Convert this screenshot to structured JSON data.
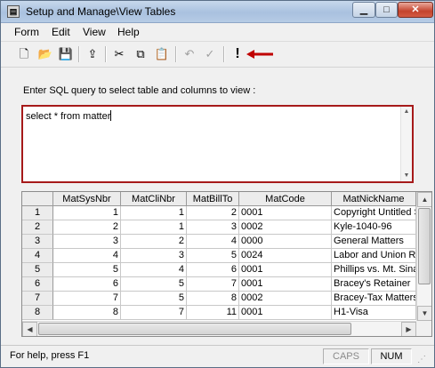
{
  "window": {
    "title": "Setup and Manage\\View Tables"
  },
  "menu": [
    "Form",
    "Edit",
    "View",
    "Help"
  ],
  "toolbar": {
    "buttons": [
      "new-icon",
      "open-icon",
      "save-icon",
      "up-folder-icon",
      "cut-icon",
      "copy-icon",
      "paste-icon",
      "undo-icon",
      "spellcheck-icon",
      "execute-icon"
    ],
    "execute_glyph": "!",
    "arrow_color": "#c00000"
  },
  "query": {
    "prompt": "Enter SQL query to select table and columns to view :",
    "value": "select * from matter",
    "border_color": "#a61a1a"
  },
  "table": {
    "columns": [
      "MatSysNbr",
      "MatCliNbr",
      "MatBillTo",
      "MatCode",
      "MatNickName"
    ],
    "rows": [
      [
        "1",
        "1",
        "1",
        "2",
        "0001",
        "Copyright Untitled S"
      ],
      [
        "2",
        "2",
        "1",
        "3",
        "0002",
        "Kyle-1040-96"
      ],
      [
        "3",
        "3",
        "2",
        "4",
        "0000",
        "General Matters"
      ],
      [
        "4",
        "4",
        "3",
        "5",
        "0024",
        "Labor and Union R"
      ],
      [
        "5",
        "5",
        "4",
        "6",
        "0001",
        "Phillips vs. Mt. Sina"
      ],
      [
        "6",
        "6",
        "5",
        "7",
        "0001",
        "Bracey's Retainer"
      ],
      [
        "7",
        "7",
        "5",
        "8",
        "0002",
        "Bracey-Tax Matters"
      ],
      [
        "8",
        "8",
        "7",
        "11",
        "0001",
        "H1-Visa"
      ]
    ]
  },
  "status": {
    "text": "For help, press F1",
    "caps": "CAPS",
    "num": "NUM"
  }
}
